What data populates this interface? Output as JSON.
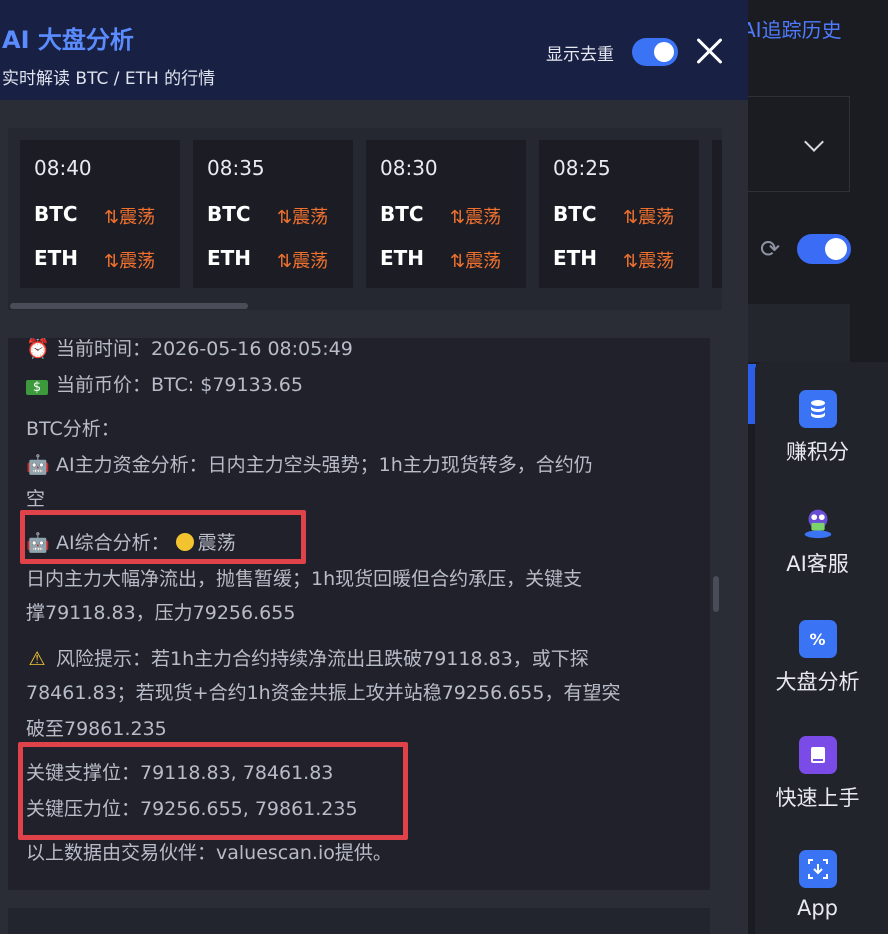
{
  "background": {
    "history_link": "AI追踪历史"
  },
  "panel": {
    "title": "AI 大盘分析",
    "subtitle": "实时解读 BTC / ETH 的行情",
    "dedup_label": "显示去重",
    "dedup_on": true
  },
  "cards": [
    {
      "time": "08:40",
      "btc": "BTC",
      "btc_state": "⇅震荡",
      "eth": "ETH",
      "eth_state": "⇅震荡"
    },
    {
      "time": "08:35",
      "btc": "BTC",
      "btc_state": "⇅震荡",
      "eth": "ETH",
      "eth_state": "⇅震荡"
    },
    {
      "time": "08:30",
      "btc": "BTC",
      "btc_state": "⇅震荡",
      "eth": "ETH",
      "eth_state": "⇅震荡"
    },
    {
      "time": "08:25",
      "btc": "BTC",
      "btc_state": "⇅震荡",
      "eth": "ETH",
      "eth_state": "⇅震荡"
    }
  ],
  "analysis": {
    "current_time": "当前时间：2026-05-16 08:05:49",
    "current_price": "当前币价：BTC: $79133.65",
    "btc_heading": "BTC分析：",
    "fund_line1": "AI主力资金分析：日内主力空头强势；1h主力现货转多，合约仍",
    "fund_line2": "空",
    "overall_label": "AI综合分析：",
    "overall_state": "震荡",
    "desc_line1": "日内主力大幅净流出，抛售暂缓；1h现货回暖但合约承压，关键支",
    "desc_line2": "撑79118.83，压力79256.655",
    "risk_line1": "风险提示：若1h主力合约持续净流出且跌破79118.83，或下探",
    "risk_line2": "78461.83；若现货+合约1h资金共振上攻并站稳79256.655，有望突",
    "risk_line3": "破至79861.235",
    "support": "关键支撑位：79118.83, 78461.83",
    "resistance": "关键压力位：79256.655, 79861.235",
    "source": "以上数据由交易伙伴：valuescan.io提供。"
  },
  "toolbar": [
    {
      "label": "赚积分",
      "icon": "coins-icon"
    },
    {
      "label": "AI客服",
      "icon": "bot-mascot-icon"
    },
    {
      "label": "大盘分析",
      "icon": "percent-grid-icon"
    },
    {
      "label": "快速上手",
      "icon": "book-icon"
    },
    {
      "label": "App",
      "icon": "download-app-icon"
    }
  ],
  "colors": {
    "accent": "#3b73f5",
    "up_down": "#f0712f",
    "highlight": "#e0424a"
  }
}
